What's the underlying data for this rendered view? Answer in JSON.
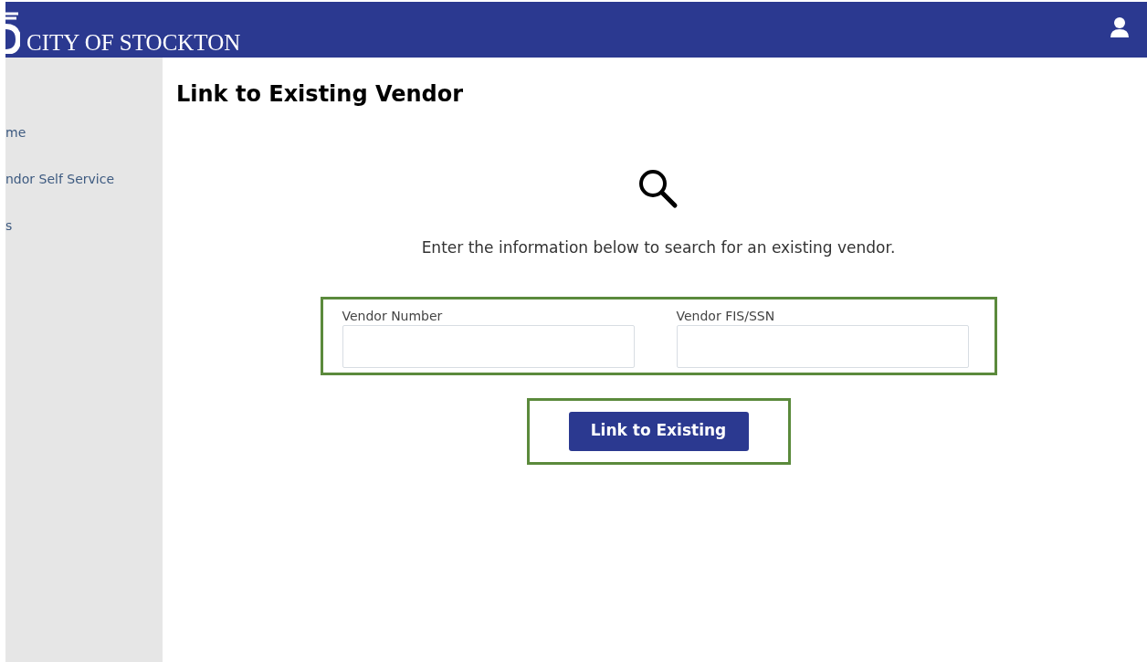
{
  "header": {
    "brand": "CITY OF STOCKTON"
  },
  "sidebar": {
    "items": [
      {
        "label": "me"
      },
      {
        "label": "ndor Self Service"
      },
      {
        "label": "s"
      }
    ]
  },
  "page": {
    "title": "Link to Existing Vendor",
    "instructions": "Enter the information below to search for an existing vendor.",
    "fields": [
      {
        "label": "Vendor Number"
      },
      {
        "label": "Vendor FIS/SSN"
      }
    ],
    "button": "Link to Existing"
  }
}
